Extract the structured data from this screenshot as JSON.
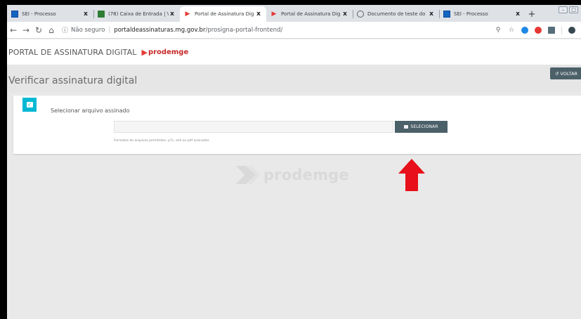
{
  "browser": {
    "tabs": [
      {
        "favicon": "sei-icon",
        "title": "SEI - Processo",
        "close": "x",
        "active": false
      },
      {
        "favicon": "mail-icon",
        "title": "(78) Caixa de Entrada | V",
        "close": "x",
        "active": false
      },
      {
        "favicon": "prodemge-icon",
        "title": "Portal de Assinatura Dig",
        "close": "x",
        "active": true
      },
      {
        "favicon": "prodemge-icon",
        "title": "Portal de Assinatura Dig",
        "close": "x",
        "active": false
      },
      {
        "favicon": "document-icon",
        "title": "Documento de teste do",
        "close": "x",
        "active": false
      },
      {
        "favicon": "sei-icon",
        "title": "SEI - Processo",
        "close": "x",
        "active": false
      }
    ],
    "new_tab": "+",
    "address": {
      "security": "Não seguro",
      "separator": "|",
      "host": "portaldeassinaturas.mg.gov.br",
      "path": "/prosigna-portal-frontend/"
    }
  },
  "app": {
    "title": "PORTAL DE ASSINATURA DIGITAL",
    "brand_name": "prodemge",
    "brand_color": "#c62828"
  },
  "page": {
    "title": "Verificar assinatura digital",
    "back_label": "VOLTAR"
  },
  "step": {
    "label": "Selecionar arquivo assinado",
    "file_value": "",
    "select_label": "SELECIONAR",
    "formats_hint": "Formatos de arquivos permitidos: p7s, xml ou pdf assinados"
  },
  "watermark": {
    "text": "prodemge"
  },
  "colors": {
    "accent": "#00b8d4",
    "button": "#4b6068",
    "annotation_arrow": "#e8101a"
  }
}
